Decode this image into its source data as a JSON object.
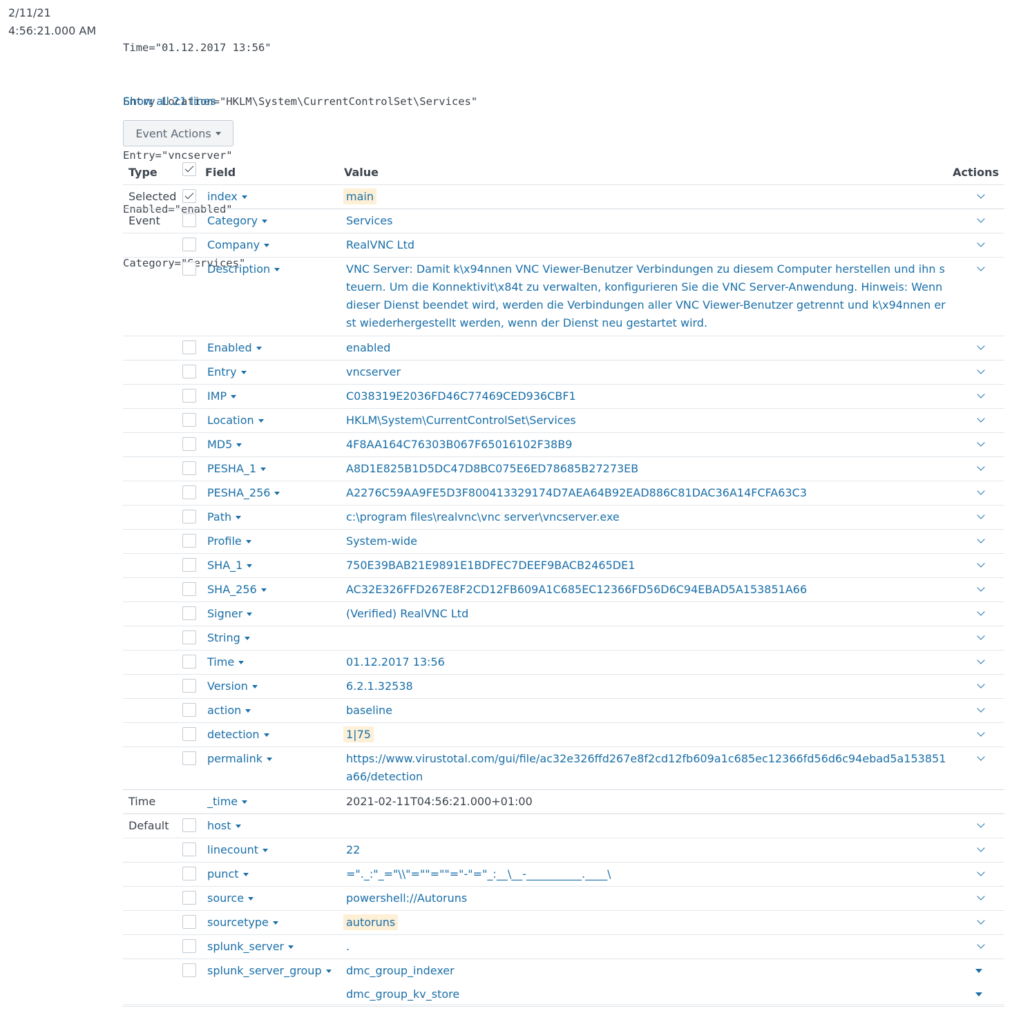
{
  "event": {
    "date": "2/11/21",
    "time": "4:56:21.000 AM",
    "raw_lines": [
      "Time=\"01.12.2017 13:56\"",
      "Entry Location=\"HKLM\\System\\CurrentControlSet\\Services\"",
      "Entry=\"vncserver\"",
      "Enabled=\"enabled\"",
      "Category=\"Services\""
    ],
    "show_all": "Show all 21 lines",
    "actions_button": "Event Actions"
  },
  "table": {
    "headers": {
      "type": "Type",
      "field": "Field",
      "value": "Value",
      "actions": "Actions"
    },
    "groups": {
      "selected": "Selected",
      "event": "Event",
      "time": "Time",
      "default": "Default"
    },
    "rows": [
      {
        "type": "Selected",
        "checked": true,
        "field": "index",
        "value": "main",
        "highlight": true
      },
      {
        "type": "Event",
        "field": "Category",
        "value": "Services"
      },
      {
        "field": "Company",
        "value": "RealVNC Ltd"
      },
      {
        "field": "Description",
        "value": "VNC Server: Damit k\\x94nnen VNC Viewer-Benutzer Verbindungen zu diesem Computer herstellen und ihn steuern. Um die Konnektivit\\x84t zu verwalten, konfigurieren Sie die VNC Server-Anwendung. Hinweis: Wenn dieser Dienst beendet wird, werden die Verbindungen aller VNC Viewer-Benutzer getrennt und k\\x94nnen erst wiederhergestellt werden, wenn der Dienst neu gestartet wird."
      },
      {
        "field": "Enabled",
        "value": "enabled"
      },
      {
        "field": "Entry",
        "value": "vncserver"
      },
      {
        "field": "IMP",
        "value": "C038319E2036FD46C77469CED936CBF1"
      },
      {
        "field": "Location",
        "value": "HKLM\\System\\CurrentControlSet\\Services"
      },
      {
        "field": "MD5",
        "value": "4F8AA164C76303B067F65016102F38B9"
      },
      {
        "field": "PESHA_1",
        "value": "A8D1E825B1D5DC47D8BC075E6ED78685B27273EB"
      },
      {
        "field": "PESHA_256",
        "value": "A2276C59AA9FE5D3F800413329174D7AEA64B92EAD886C81DAC36A14FCFA63C3"
      },
      {
        "field": "Path",
        "value": "c:\\program files\\realvnc\\vnc server\\vncserver.exe"
      },
      {
        "field": "Profile",
        "value": "System-wide"
      },
      {
        "field": "SHA_1",
        "value": "750E39BAB21E9891E1BDFEC7DEEF9BACB2465DE1"
      },
      {
        "field": "SHA_256",
        "value": "AC32E326FFD267E8F2CD12FB609A1C685EC12366FD56D6C94EBAD5A153851A66"
      },
      {
        "field": "Signer",
        "value": "(Verified) RealVNC Ltd"
      },
      {
        "field": "String",
        "value": ""
      },
      {
        "field": "Time",
        "value": "01.12.2017 13:56"
      },
      {
        "field": "Version",
        "value": "6.2.1.32538"
      },
      {
        "field": "action",
        "value": "baseline"
      },
      {
        "field": "detection",
        "value": "1|75",
        "highlight": true
      },
      {
        "field": "permalink",
        "value": "https://www.virustotal.com/gui/file/ac32e326ffd267e8f2cd12fb609a1c685ec12366fd56d6c94ebad5a153851a66/detection"
      },
      {
        "type": "Time",
        "nocheck": true,
        "field": "_time",
        "value": "2021-02-11T04:56:21.000+01:00",
        "plain": true,
        "noaction": true
      },
      {
        "type": "Default",
        "field": "host",
        "value": ""
      },
      {
        "field": "linecount",
        "value": "22"
      },
      {
        "field": "punct",
        "value": "=\"._:\"_=\"\\\\\"=\"\"=\"\"=\"-\"=\"_:__\\__-__________.____\\"
      },
      {
        "field": "source",
        "value": "powershell://Autoruns"
      },
      {
        "field": "sourcetype",
        "value": "autoruns",
        "highlight": true
      },
      {
        "field": "splunk_server",
        "value": "."
      },
      {
        "field": "splunk_server_group",
        "value": "dmc_group_indexer",
        "tri": true
      },
      {
        "nocheck": true,
        "field": "",
        "value": "dmc_group_kv_store",
        "tri": true
      }
    ]
  }
}
